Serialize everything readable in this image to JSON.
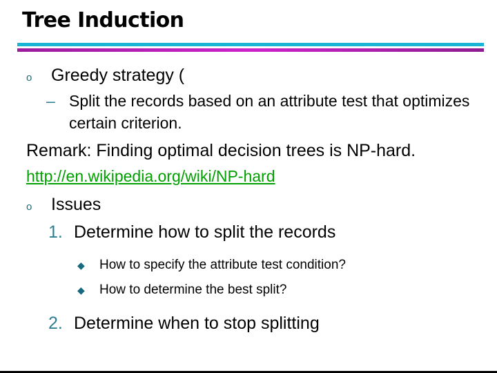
{
  "slide": {
    "title": "Tree Induction",
    "divider": {
      "top_color": "#1ab5d5",
      "bottom_color": "#a81ba8"
    },
    "accent_color": "#1f6b78",
    "link_color": "#00a000",
    "bullets": {
      "circle": "o",
      "dash": "–",
      "diamond": "◆"
    },
    "content": {
      "greedy_strategy": {
        "marker": "o",
        "text": "Greedy strategy ("
      },
      "split_records": {
        "marker": "–",
        "text": "Split the records based on an attribute test that optimizes certain criterion."
      },
      "remark": "Remark: Finding optimal decision trees is NP-hard.",
      "link": "http://en.wikipedia.org/wiki/NP-hard",
      "issues": {
        "marker": "o",
        "text": "Issues"
      },
      "issue_1": {
        "marker": "1.",
        "text": "Determine how to split the records"
      },
      "issue_1_sub_a": {
        "marker": "◆",
        "text": "How to specify the attribute test condition?"
      },
      "issue_1_sub_b": {
        "marker": "◆",
        "text": "How to determine the best split?"
      },
      "issue_2": {
        "marker": "2.",
        "text": "Determine when to stop splitting"
      }
    }
  }
}
